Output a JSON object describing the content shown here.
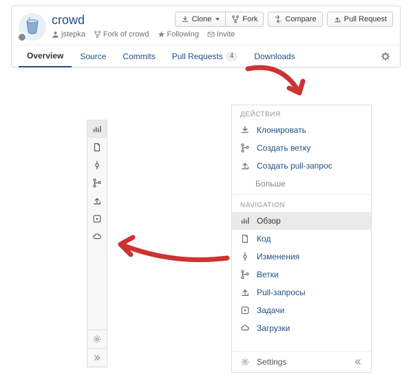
{
  "repo": {
    "title": "crowd",
    "owner": "jstepka",
    "fork_of": "Fork of crowd",
    "following": "Following",
    "invite": "Invite"
  },
  "actions": {
    "clone": "Clone",
    "fork": "Fork",
    "compare": "Compare",
    "pull_request": "Pull Request"
  },
  "tabs": {
    "overview": "Overview",
    "source": "Source",
    "commits": "Commits",
    "pull_requests": "Pull Requests",
    "pull_requests_count": "4",
    "downloads": "Downloads"
  },
  "panel": {
    "section_actions": "ДЕЙСТВИЯ",
    "clone": "Клонировать",
    "create_branch": "Создать ветку",
    "create_pr": "Создать pull-запрос",
    "more": "Больше",
    "section_nav": "NAVIGATION",
    "overview": "Обзор",
    "code": "Код",
    "changes": "Изменения",
    "branches": "Ветки",
    "pull_requests": "Pull-запросы",
    "issues": "Задачи",
    "downloads": "Загрузки",
    "settings": "Settings"
  }
}
